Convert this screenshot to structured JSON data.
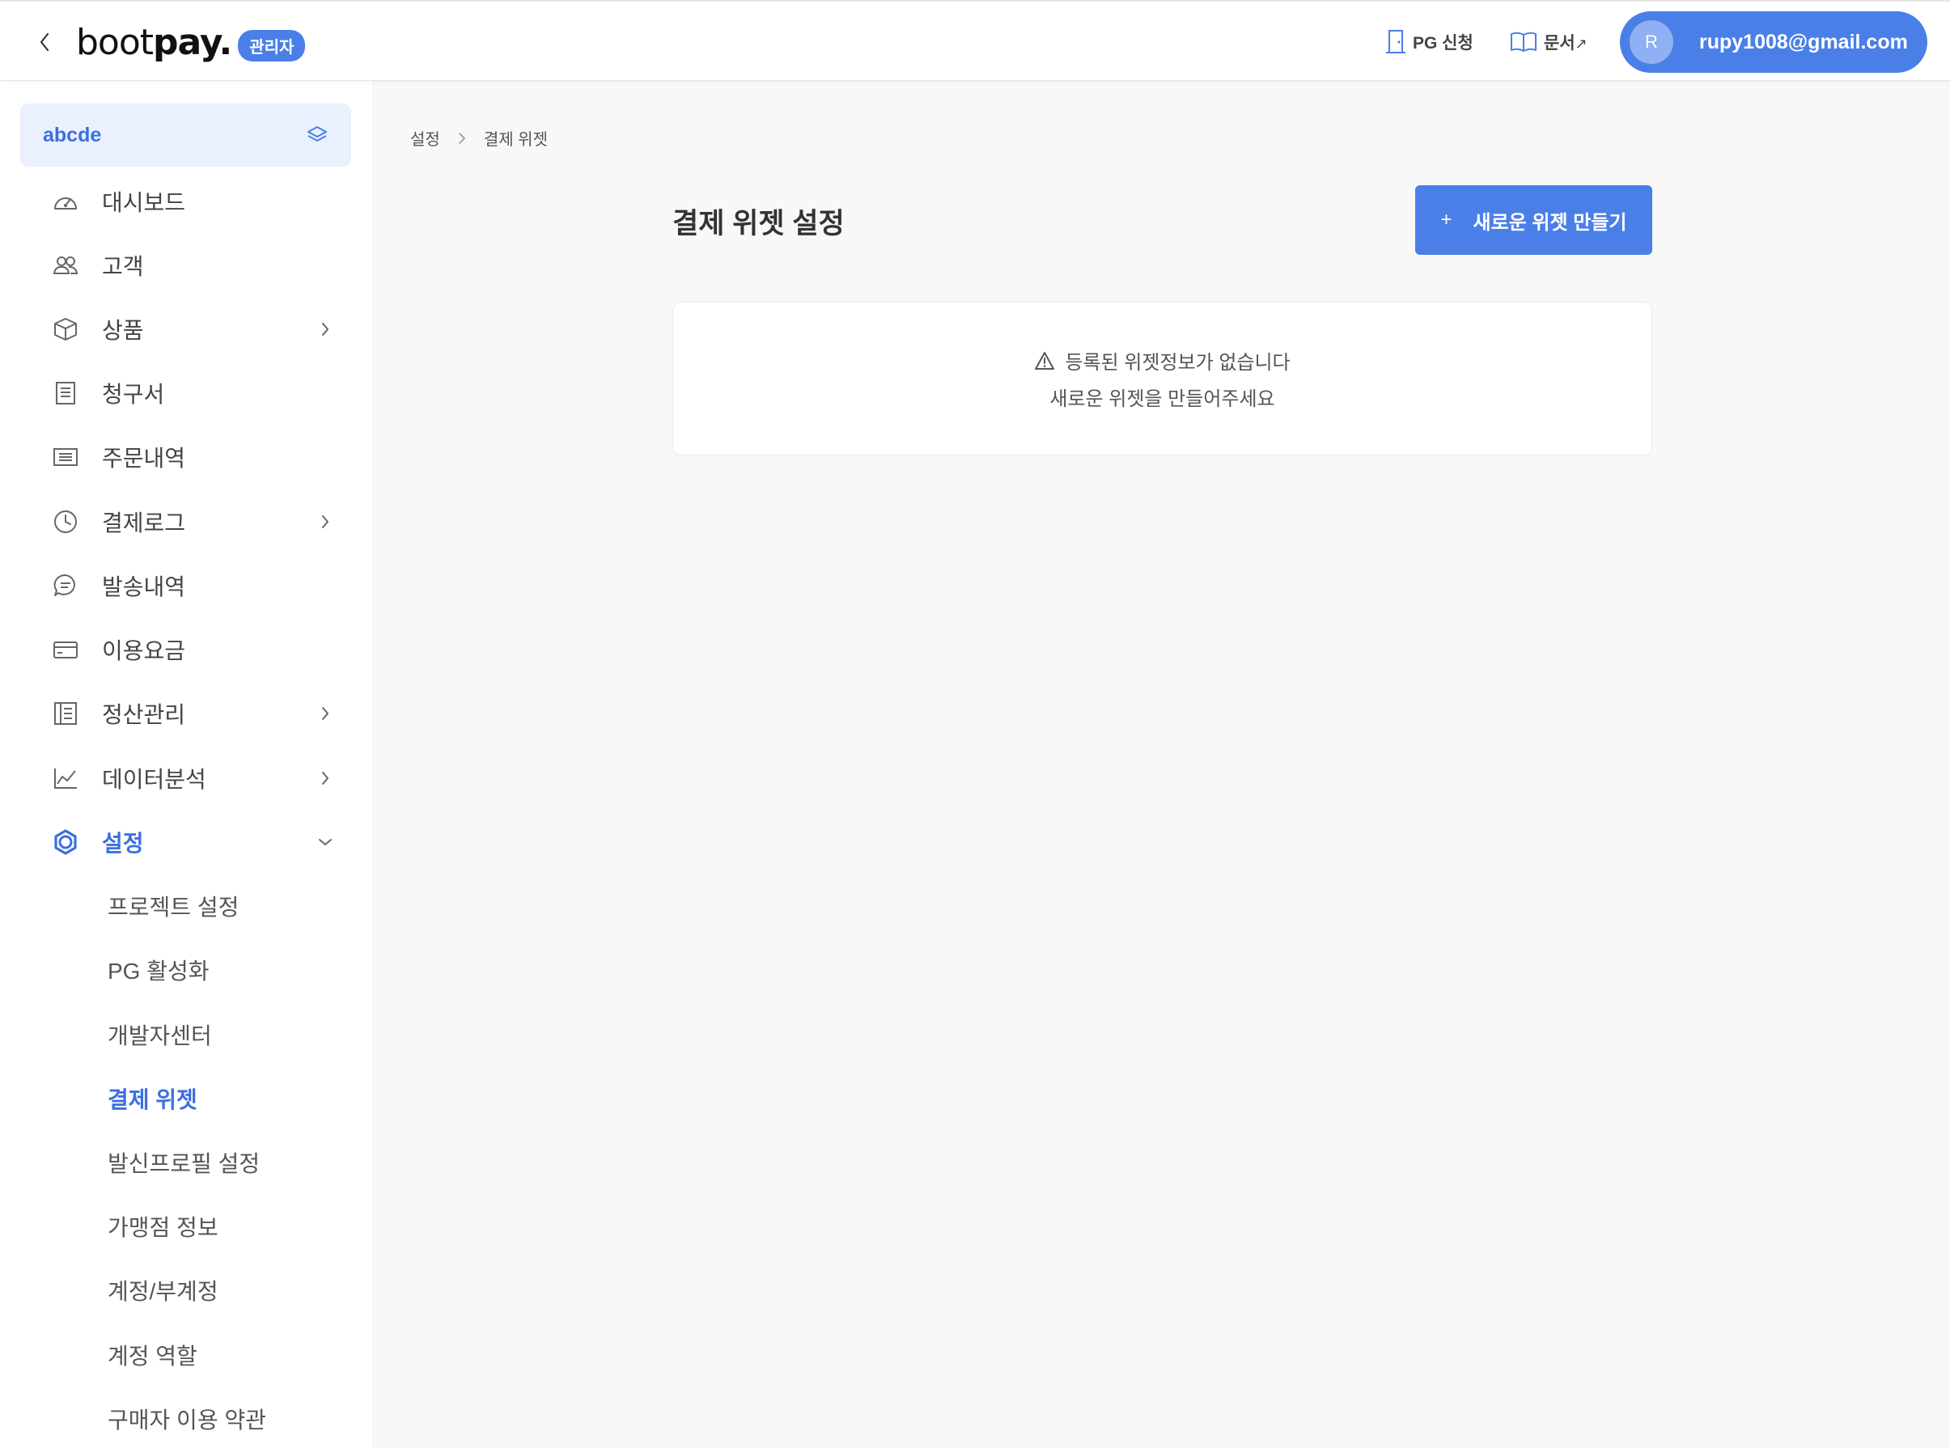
{
  "header": {
    "logo_text_light": "boot",
    "logo_text_bold": "pay.",
    "logo_badge": "관리자",
    "pg_apply_label": "PG 신청",
    "docs_label": "문서",
    "docs_ext_mark": "↗",
    "avatar_initial": "R",
    "user_email": "rupy1008@gmail.com"
  },
  "sidebar": {
    "project_name": "abcde",
    "items": [
      {
        "label": "대시보드",
        "icon": "dashboard-icon",
        "has_chevron": false
      },
      {
        "label": "고객",
        "icon": "users-icon",
        "has_chevron": false
      },
      {
        "label": "상품",
        "icon": "box-icon",
        "has_chevron": true
      },
      {
        "label": "청구서",
        "icon": "invoice-icon",
        "has_chevron": false
      },
      {
        "label": "주문내역",
        "icon": "list-icon",
        "has_chevron": false
      },
      {
        "label": "결제로그",
        "icon": "clock-icon",
        "has_chevron": true
      },
      {
        "label": "발송내역",
        "icon": "message-icon",
        "has_chevron": false
      },
      {
        "label": "이용요금",
        "icon": "card-icon",
        "has_chevron": false
      },
      {
        "label": "정산관리",
        "icon": "ledger-icon",
        "has_chevron": true
      },
      {
        "label": "데이터분석",
        "icon": "chart-icon",
        "has_chevron": true
      },
      {
        "label": "설정",
        "icon": "gear-icon",
        "has_chevron": true,
        "active": true
      }
    ],
    "settings_sub_items": [
      {
        "label": "프로젝트 설정"
      },
      {
        "label": "PG 활성화"
      },
      {
        "label": "개발자센터"
      },
      {
        "label": "결제 위젯",
        "active": true
      },
      {
        "label": "발신프로필 설정"
      },
      {
        "label": "가맹점 정보"
      },
      {
        "label": "계정/부계정"
      },
      {
        "label": "계정 역할"
      },
      {
        "label": "구매자 이용 약관"
      }
    ]
  },
  "main": {
    "breadcrumb": [
      "설정",
      "결제 위젯"
    ],
    "page_title": "결제 위젯 설정",
    "create_button_label": "새로운 위젯 만들기",
    "create_button_plus": "+",
    "empty_line1": "등록된 위젯정보가 없습니다",
    "empty_line2": "새로운 위젯을 만들어주세요"
  },
  "colors": {
    "accent": "#4a7fe8",
    "active_text": "#3b6fe0",
    "project_bg": "#eaf0fd",
    "main_bg": "#f8f8f8"
  }
}
